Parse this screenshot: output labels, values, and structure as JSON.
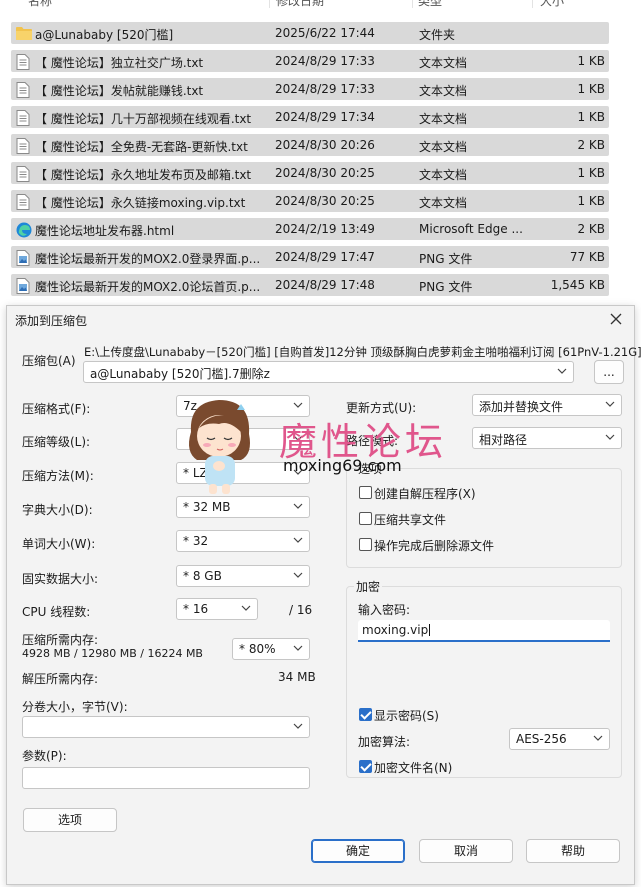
{
  "columns": {
    "name": "名称",
    "date": "修改日期",
    "type": "类型",
    "size": "大小"
  },
  "files": [
    {
      "icon": "folder-icon",
      "name": "a@Lunababy [520门槛]",
      "date": "2025/6/22 17:44",
      "type": "文件夹",
      "size": ""
    },
    {
      "icon": "text-file-icon",
      "name": "【 魔性论坛】独立社交广场.txt",
      "date": "2024/8/29 17:33",
      "type": "文本文档",
      "size": "1 KB"
    },
    {
      "icon": "text-file-icon",
      "name": "【 魔性论坛】发帖就能赚钱.txt",
      "date": "2024/8/29 17:33",
      "type": "文本文档",
      "size": "1 KB"
    },
    {
      "icon": "text-file-icon",
      "name": "【 魔性论坛】几十万部视频在线观看.txt",
      "date": "2024/8/29 17:34",
      "type": "文本文档",
      "size": "1 KB"
    },
    {
      "icon": "text-file-icon",
      "name": "【 魔性论坛】全免费-无套路-更新快.txt",
      "date": "2024/8/30 20:26",
      "type": "文本文档",
      "size": "2 KB"
    },
    {
      "icon": "text-file-icon",
      "name": "【 魔性论坛】永久地址发布页及邮箱.txt",
      "date": "2024/8/30 20:25",
      "type": "文本文档",
      "size": "1 KB"
    },
    {
      "icon": "text-file-icon",
      "name": "【 魔性论坛】永久链接moxing.vip.txt",
      "date": "2024/8/30 20:25",
      "type": "文本文档",
      "size": "1 KB"
    },
    {
      "icon": "edge-html-icon",
      "name": "魔性论坛地址发布器.html",
      "date": "2024/2/19 13:49",
      "type": "Microsoft Edge ...",
      "size": "2 KB"
    },
    {
      "icon": "png-file-icon",
      "name": "魔性论坛最新开发的MOX2.0登录界面.p...",
      "date": "2024/8/29 17:47",
      "type": "PNG 文件",
      "size": "77 KB"
    },
    {
      "icon": "png-file-icon",
      "name": "魔性论坛最新开发的MOX2.0论坛首页.p...",
      "date": "2024/8/29 17:48",
      "type": "PNG 文件",
      "size": "1,545 KB"
    }
  ],
  "dialog": {
    "title": "添加到压缩包",
    "archive_label": "压缩包(A)",
    "archive_dir": "E:\\上传度盘\\Lunababy－[520门槛] [自购首发]12分钟 顶级酥胸白虎萝莉金主啪啪福利订阅 [61PnV-1.21G]",
    "archive_name": "a@Lunababy [520门槛].7删除z",
    "browse_label": "...",
    "format_label": "压缩格式(F):",
    "format_value": "7z",
    "level_label": "压缩等级(L):",
    "level_value": "",
    "method_label": "压缩方法(M):",
    "method_value": "* LZMA2",
    "dict_label": "字典大小(D):",
    "dict_value": "* 32 MB",
    "word_label": "单词大小(W):",
    "word_value": "* 32",
    "solid_label": "固实数据大小:",
    "solid_value": "* 8 GB",
    "cpu_label": "CPU 线程数:",
    "cpu_value": "* 16",
    "cpu_total": "/ 16",
    "mem_comp_label": "压缩所需内存:",
    "mem_comp_value": "4928 MB / 12980 MB / 16224 MB",
    "mem_pct": "* 80%",
    "mem_decomp_label": "解压所需内存:",
    "mem_decomp_value": "34 MB",
    "volume_label": "分卷大小，字节(V):",
    "volume_value": "",
    "params_label": "参数(P):",
    "params_value": "",
    "options_button": "选项",
    "update_label": "更新方式(U):",
    "update_value": "添加并替换文件",
    "path_label": "路径模式:",
    "path_value": "相对路径",
    "options_group": "选项",
    "opt_sfx": "创建自解压程序(X)",
    "opt_shared": "压缩共享文件",
    "opt_delete": "操作完成后删除源文件",
    "encrypt_group": "加密",
    "password_label": "输入密码:",
    "password_value": "moxing.vip",
    "show_password": "显示密码(S)",
    "enc_method_label": "加密算法:",
    "enc_method_value": "AES-256",
    "encrypt_names": "加密文件名(N)",
    "ok": "确定",
    "cancel": "取消",
    "help": "帮助"
  },
  "watermark": {
    "title": "魔性论坛",
    "url": "moxing69.com"
  },
  "colors": {
    "row_bg": "#d9d9d9",
    "accent": "#2a6fc9",
    "watermark": "#e0568c"
  }
}
